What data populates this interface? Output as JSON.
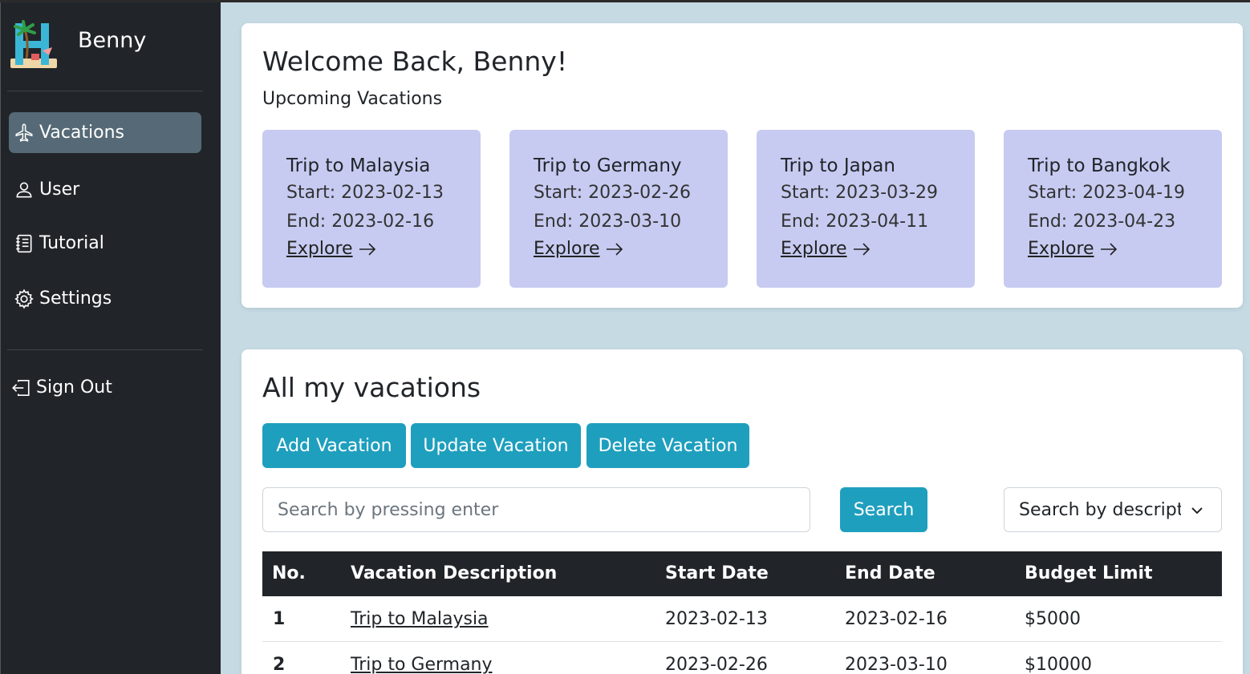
{
  "sidebar": {
    "user_name": "Benny",
    "nav": [
      {
        "label": "Vacations",
        "icon": "airplane-icon",
        "active": true
      },
      {
        "label": "User",
        "icon": "person-icon"
      },
      {
        "label": "Tutorial",
        "icon": "journal-icon"
      },
      {
        "label": "Settings",
        "icon": "gear-icon"
      }
    ],
    "sign_out": {
      "label": "Sign Out",
      "icon": "box-arrow-left-icon"
    }
  },
  "welcome": {
    "title": "Welcome Back, Benny!",
    "subtitle": "Upcoming Vacations"
  },
  "upcoming": [
    {
      "title": "Trip to Malaysia",
      "start": "Start: 2023-02-13",
      "end": "End: 2023-02-16",
      "link": "Explore"
    },
    {
      "title": "Trip to Germany",
      "start": "Start: 2023-02-26",
      "end": "End: 2023-03-10",
      "link": "Explore"
    },
    {
      "title": "Trip to Japan",
      "start": "Start: 2023-03-29",
      "end": "End: 2023-04-11",
      "link": "Explore"
    },
    {
      "title": "Trip to Bangkok",
      "start": "Start: 2023-04-19",
      "end": "End: 2023-04-23",
      "link": "Explore"
    }
  ],
  "vacations": {
    "title": "All my vacations",
    "buttons": {
      "add": "Add Vacation",
      "update": "Update Vacation",
      "delete": "Delete Vacation"
    },
    "search": {
      "placeholder": "Search by pressing enter",
      "value": "",
      "button": "Search",
      "filter_selected": "Search by description"
    },
    "table": {
      "headers": [
        "No.",
        "Vacation Description",
        "Start Date",
        "End Date",
        "Budget Limit"
      ],
      "rows": [
        [
          "1",
          "Trip to Malaysia",
          "2023-02-13",
          "2023-02-16",
          "$5000"
        ],
        [
          "2",
          "Trip to Germany",
          "2023-02-26",
          "2023-03-10",
          "$10000"
        ]
      ]
    }
  },
  "colors": {
    "sidebar_bg": "#212529",
    "page_bg": "#c5dae3",
    "active_nav": "#556a76",
    "trip_card": "#c7cbf1",
    "button": "#1f9fbe"
  }
}
